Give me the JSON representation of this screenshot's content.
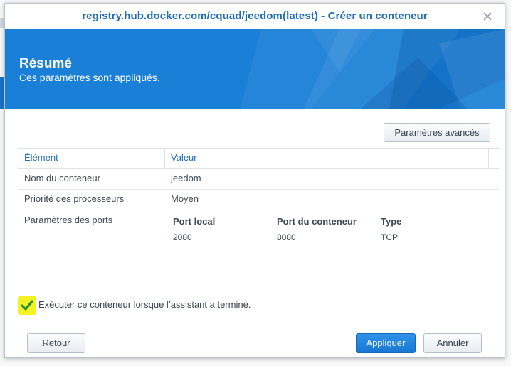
{
  "window": {
    "title": "registry.hub.docker.com/cquad/jeedom(latest) - Créer un conteneur",
    "close_icon": "close-icon"
  },
  "banner": {
    "title": "Résumé",
    "subtitle": "Ces paramètres sont appliqués."
  },
  "toolbar": {
    "advanced_label": "Paramètres avancés"
  },
  "table": {
    "headers": {
      "element": "Élément",
      "value": "Valeur"
    },
    "rows": [
      {
        "label": "Nom du conteneur",
        "value": "jeedom"
      },
      {
        "label": "Priorité des processeurs",
        "value": "Moyen"
      }
    ],
    "ports": {
      "label": "Paramètres des ports",
      "headers": [
        "Port local",
        "Port du conteneur",
        "Type"
      ],
      "values": [
        "2080",
        "8080",
        "TCP"
      ]
    }
  },
  "run_after": {
    "checked": true,
    "label": "Exécuter ce conteneur lorsque l’assistant a terminé."
  },
  "footer": {
    "back_label": "Retour",
    "apply_label": "Appliquer",
    "cancel_label": "Annuler"
  },
  "colors": {
    "accent": "#1a7fd6",
    "title_text": "#1f6db8",
    "highlight": "#f2f224",
    "check": "#1f8a2b"
  }
}
